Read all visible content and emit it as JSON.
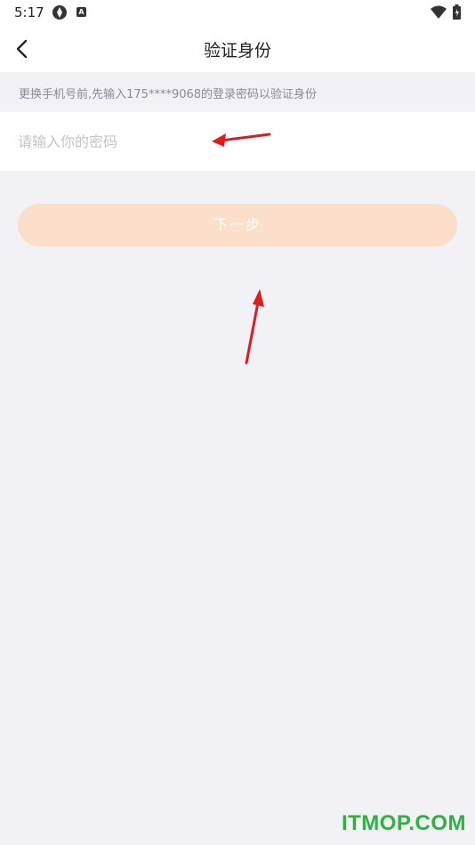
{
  "status_bar": {
    "time": "5:17",
    "app_icon_letter": "A"
  },
  "header": {
    "title": "验证身份",
    "back_icon": "chevron-left-icon"
  },
  "hint": {
    "text": "更换手机号前,先输入175****9068的登录密码以验证身份"
  },
  "password_field": {
    "placeholder": "请输入你的密码",
    "value": ""
  },
  "next_button": {
    "label": "下一步",
    "color": "#fbdfca"
  },
  "annotations": {
    "arrow_color": "#e01b1b"
  },
  "watermark": {
    "text": "ITMOP.COM",
    "color": "#2fb13f"
  }
}
